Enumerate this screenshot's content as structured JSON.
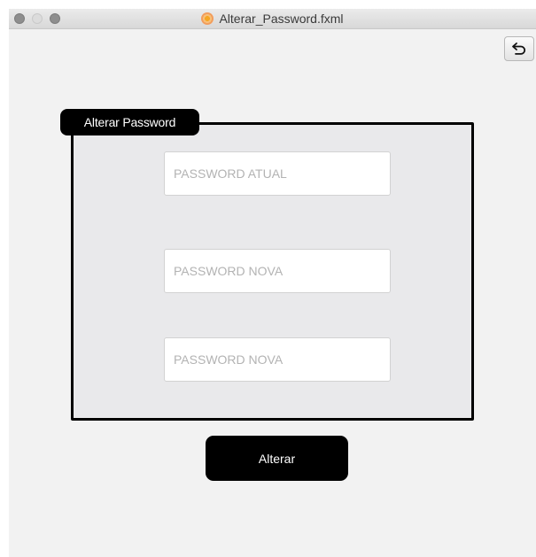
{
  "window": {
    "title": "Alterar_Password.fxml",
    "app_icon": "javafx-scene-builder-icon"
  },
  "toolbar": {
    "undo_icon": "undo-arrow-icon"
  },
  "form": {
    "section_label": "Alterar Password",
    "fields": [
      {
        "placeholder": "PASSWORD ATUAL",
        "value": ""
      },
      {
        "placeholder": "PASSWORD NOVA",
        "value": ""
      },
      {
        "placeholder": "PASSWORD NOVA",
        "value": ""
      }
    ],
    "submit_label": "Alterar"
  },
  "colors": {
    "window_background": "#f2f2f2",
    "panel_background": "#e9e9eb",
    "accent": "#000000",
    "accent_text": "#ffffff",
    "placeholder_text": "#b3b3b3"
  }
}
